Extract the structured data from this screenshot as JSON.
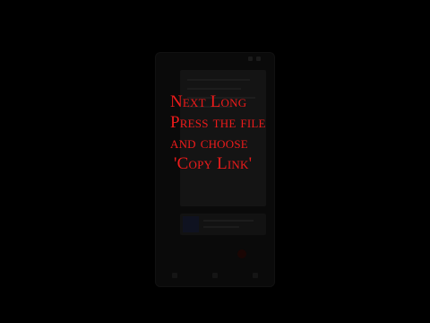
{
  "overlay": {
    "line1": "Next Long",
    "line2": "Press the file",
    "line3": "and choose",
    "line4": "'Copy Link'"
  },
  "icons": {
    "status": [
      "signal-icon",
      "battery-icon"
    ],
    "nav": [
      "back-icon",
      "home-icon",
      "recents-icon"
    ],
    "fab": "add-icon"
  },
  "colors": {
    "background": "#000000",
    "overlay_text": "#ee1b1b"
  }
}
